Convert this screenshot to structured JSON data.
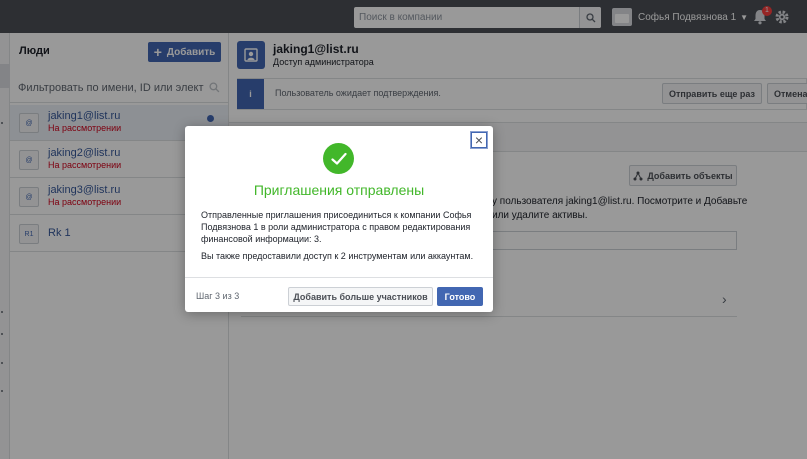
{
  "topbar": {
    "search_placeholder": "Поиск в компании",
    "account_name": "Софья Подвязнова 1",
    "notifications_count": "1"
  },
  "people": {
    "title": "Люди",
    "add_button": "Добавить",
    "filter_placeholder": "Фильтровать по имени, ID или электр…",
    "rows": [
      {
        "avatar": "@",
        "name": "jaking1@list.ru",
        "status": "На рассмотрении",
        "selected": true
      },
      {
        "avatar": "@",
        "name": "jaking2@list.ru",
        "status": "На рассмотрении"
      },
      {
        "avatar": "@",
        "name": "jaking3@list.ru",
        "status": "На рассмотрении"
      },
      {
        "avatar": "R1",
        "name": "Rk 1",
        "status": ""
      }
    ]
  },
  "main": {
    "user_name": "jaking1@list.ru",
    "user_role": "Доступ администратора",
    "notice_text": "Пользователь ожидает подтверждения.",
    "resend_button": "Отправить еще раз",
    "cancel_button": "Отмена",
    "add_objects_button": "Добавить объекты",
    "assets_text": "у пользователя jaking1@list.ru. Посмотрите и Добавьте или удалите активы."
  },
  "modal": {
    "title": "Приглашения отправлены",
    "text1": "Отправленные приглашения присоединиться к компании Софья Подвязнова 1 в роли администратора с правом редактирования финансовой информации: 3.",
    "text2": "Вы также предоставили доступ к 2 инструментам или аккаунтам.",
    "step": "Шаг 3 из 3",
    "add_more_button": "Добавить больше участников",
    "done_button": "Готово"
  },
  "colors": {
    "accent": "#4267b2",
    "success": "#42b72a",
    "pending": "#d0021b",
    "topbar": "#4b4f56"
  }
}
